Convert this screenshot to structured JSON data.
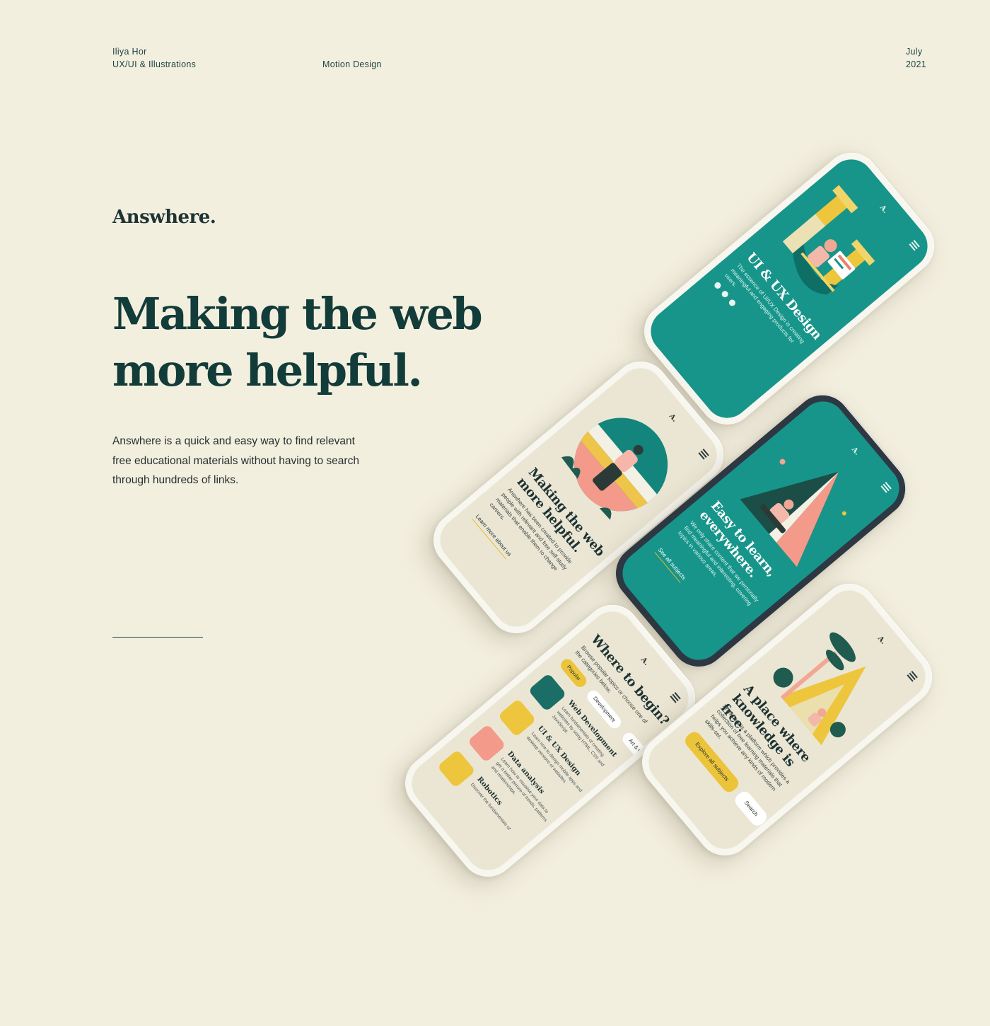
{
  "header": {
    "author_name": "Iliya Hor",
    "author_role": "UX/UI & Illustrations",
    "category": "Motion Design",
    "month": "July",
    "year": "2021"
  },
  "brand": "Answhere.",
  "headline": {
    "line1": "Making the web",
    "line2": "more helpful."
  },
  "description": "Answhere is a quick and easy way to find relevant free educational materials without having to search through hundreds of links.",
  "phones": {
    "logo": "A.",
    "uiux": {
      "title": "UI & UX Design",
      "text": "The essence of UI/UX Design is creating meaningful and engaging products for users."
    },
    "making": {
      "title_line1": "Making the web",
      "title_line2": "more helpful.",
      "text": "Answhere has been created to provide people with relevant and free self-study materials that enable them to change careers.",
      "link": "Learn more about us"
    },
    "easy": {
      "title_line1": "Easy to learn,",
      "title_line2": "everywhere.",
      "text": "We only share content that we personally find meaningful and interesting, covering topics in various areas.",
      "link": "See all subjects"
    },
    "where": {
      "title": "Where to begin?",
      "text": "Browse popular topics or choose one of the categories below.",
      "pills": [
        "Popular",
        "Development",
        "Art & C"
      ],
      "categories": [
        {
          "title": "Web Development",
          "desc": "Learn fundamentals of creating websites by using HTML, CSS and JavaScript."
        },
        {
          "title": "UI & UX Design",
          "desc": "Learn how to design mobile apps and desktop versions of websites."
        },
        {
          "title": "Data analysis",
          "desc": "Learn how to visualise your data to get a better picture of trends, patterns and relationships."
        },
        {
          "title": "Robotics",
          "desc": "Discover the fundamentals of"
        }
      ]
    },
    "place": {
      "title_line1": "A place where",
      "title_line2": "knowledge is free.",
      "text": "Answhere is a platform which provides a collection of free learning materials that helps you achieve any kinds of modern skills-set.",
      "primary_button": "Explore all subjects",
      "secondary_button": "Search"
    }
  },
  "colors": {
    "background": "#f3efdf",
    "teal": "#17958a",
    "dark_green": "#123c3a",
    "yellow": "#ecc43a",
    "pink": "#f39a8a"
  }
}
